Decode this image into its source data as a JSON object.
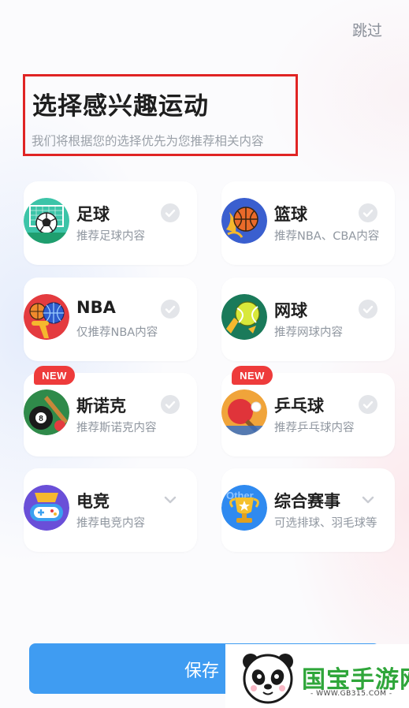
{
  "header": {
    "skip_label": "跳过",
    "title": "选择感兴趣运动",
    "subtitle": "我们将根据您的选择优先为您推荐相关内容"
  },
  "sports": [
    {
      "name": "足球",
      "desc": "推荐足球内容",
      "icon": "soccer-icon",
      "control": "check"
    },
    {
      "name": "篮球",
      "desc": "推荐NBA、CBA内容",
      "icon": "basketball-icon",
      "control": "check"
    },
    {
      "name": "NBA",
      "desc": "仅推荐NBA内容",
      "icon": "nba-icon",
      "control": "check"
    },
    {
      "name": "网球",
      "desc": "推荐网球内容",
      "icon": "tennis-icon",
      "control": "check"
    },
    {
      "name": "斯诺克",
      "desc": "推荐斯诺克内容",
      "icon": "snooker-icon",
      "badge": "NEW",
      "control": "check"
    },
    {
      "name": "乒乓球",
      "desc": "推荐乒乓球内容",
      "icon": "table-tennis-icon",
      "badge": "NEW",
      "control": "check"
    },
    {
      "name": "电竞",
      "desc": "推荐电竞内容",
      "icon": "esports-icon",
      "control": "chevron"
    },
    {
      "name": "综合赛事",
      "desc": "可选排球、羽毛球等",
      "icon": "trophy-icon",
      "icon_text": "Other",
      "control": "chevron"
    }
  ],
  "footer": {
    "save_label": "保存"
  },
  "watermark": {
    "name": "国宝手游网",
    "url": "- WWW.GB315.COM -"
  },
  "colors": {
    "accent": "#3f9cf2",
    "highlight_box": "#e02424",
    "badge": "#ee3b3b",
    "check_bg": "#e3e5e9"
  }
}
